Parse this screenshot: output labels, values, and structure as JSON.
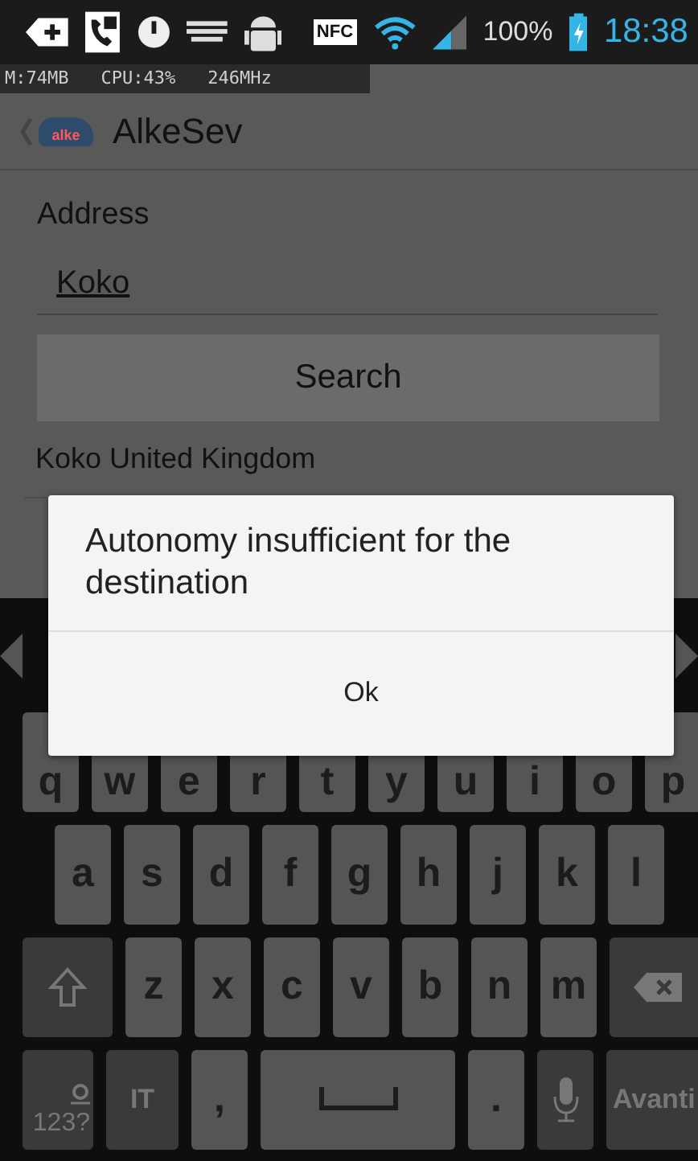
{
  "status_bar": {
    "nfc": "NFC",
    "battery": "100%",
    "time": "18:38"
  },
  "debug_overlay": [
    "M:74MB",
    "CPU:43%",
    "246MHz"
  ],
  "action_bar": {
    "logo_text": "alke",
    "title": "AlkeSev"
  },
  "form": {
    "label": "Address",
    "value": "Koko",
    "button": "Search",
    "results": [
      "Koko United Kingdom"
    ]
  },
  "dialog": {
    "message": "Autonomy insufficient for the destination",
    "buttons": [
      "Ok"
    ]
  },
  "keyboard": {
    "rows": [
      {
        "keys": [
          {
            "kind": "letter",
            "label": "q"
          },
          {
            "kind": "letter",
            "label": "w"
          },
          {
            "kind": "letter",
            "label": "e"
          },
          {
            "kind": "letter",
            "label": "r"
          },
          {
            "kind": "letter",
            "label": "t"
          },
          {
            "kind": "letter",
            "label": "y"
          },
          {
            "kind": "letter",
            "label": "u"
          },
          {
            "kind": "letter",
            "label": "i"
          },
          {
            "kind": "letter",
            "label": "o"
          },
          {
            "kind": "letter",
            "label": "p"
          }
        ]
      },
      {
        "keys": [
          {
            "kind": "letter",
            "label": "a"
          },
          {
            "kind": "letter",
            "label": "s"
          },
          {
            "kind": "letter",
            "label": "d"
          },
          {
            "kind": "letter",
            "label": "f"
          },
          {
            "kind": "letter",
            "label": "g"
          },
          {
            "kind": "letter",
            "label": "h"
          },
          {
            "kind": "letter",
            "label": "j"
          },
          {
            "kind": "letter",
            "label": "k"
          },
          {
            "kind": "letter",
            "label": "l"
          }
        ]
      },
      {
        "keys": [
          {
            "kind": "shift"
          },
          {
            "kind": "letter",
            "label": "z"
          },
          {
            "kind": "letter",
            "label": "x"
          },
          {
            "kind": "letter",
            "label": "c"
          },
          {
            "kind": "letter",
            "label": "v"
          },
          {
            "kind": "letter",
            "label": "b"
          },
          {
            "kind": "letter",
            "label": "n"
          },
          {
            "kind": "letter",
            "label": "m"
          },
          {
            "kind": "backspace"
          }
        ]
      },
      {
        "keys": [
          {
            "kind": "symbols",
            "label": "123?"
          },
          {
            "kind": "lang",
            "label": "IT"
          },
          {
            "kind": "letter",
            "label": ","
          },
          {
            "kind": "space"
          },
          {
            "kind": "letter",
            "label": "."
          },
          {
            "kind": "mic"
          },
          {
            "kind": "enter",
            "label": "Avanti"
          }
        ]
      }
    ]
  }
}
